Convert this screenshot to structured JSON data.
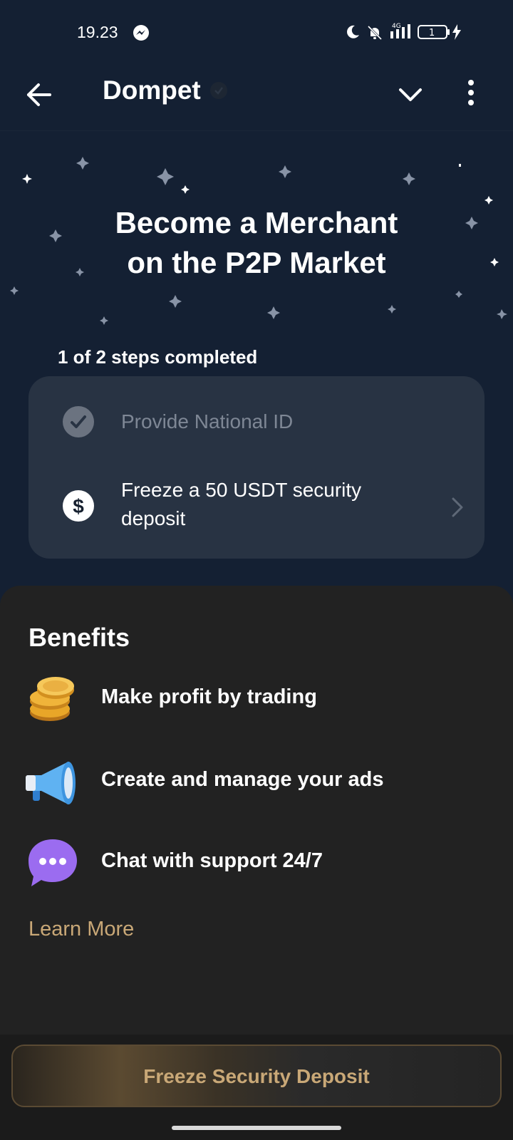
{
  "status_bar": {
    "time": "19.23",
    "icons": [
      "messenger-icon",
      "moon-icon",
      "bell-off-icon",
      "signal-4g-icon",
      "battery-icon",
      "charging-icon"
    ],
    "network": "4G",
    "battery_level": "1"
  },
  "nav": {
    "title": "Dompet",
    "icons": [
      "back-arrow-icon",
      "verified-badge-icon",
      "chevron-down-icon",
      "more-vertical-icon"
    ]
  },
  "hero": {
    "headline_line1": "Become a Merchant",
    "headline_line2": "on the P2P Market"
  },
  "steps": {
    "caption": "1 of 2 steps completed",
    "completed_count": 1,
    "total_count": 2,
    "items": [
      {
        "label": "Provide National ID",
        "icon": "check-circle-icon",
        "completed": true
      },
      {
        "label": "Freeze a 50 USDT security deposit",
        "icon": "dollar-circle-icon",
        "completed": false
      }
    ]
  },
  "benefits": {
    "title": "Benefits",
    "items": [
      {
        "label": "Make profit by trading",
        "icon": "coins-icon"
      },
      {
        "label": "Create and manage your ads",
        "icon": "megaphone-icon"
      },
      {
        "label": "Chat with support 24/7",
        "icon": "chat-bubble-icon"
      }
    ],
    "learn_more": "Learn More"
  },
  "cta": {
    "label": "Freeze Security Deposit"
  },
  "colors": {
    "hero_background": "#142033",
    "card_background": "#283343",
    "sheet_background": "#222222",
    "accent_gold": "#c9a877"
  }
}
